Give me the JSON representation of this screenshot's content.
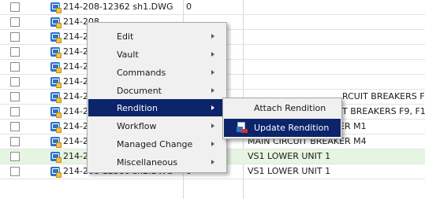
{
  "rows": [
    {
      "name": "214-208-12362 sh1.DWG",
      "version": "0",
      "description": "",
      "highlight": false
    },
    {
      "name": "214-208",
      "version": "",
      "description": "",
      "highlight": false
    },
    {
      "name": "214-208",
      "version": "",
      "description": "",
      "highlight": false
    },
    {
      "name": "214-208",
      "version": "",
      "description": "",
      "highlight": false
    },
    {
      "name": "214-208",
      "version": "",
      "description": "",
      "highlight": false
    },
    {
      "name": "214-208",
      "version": "",
      "description": "",
      "highlight": false
    },
    {
      "name": "214-208",
      "version": "",
      "description": "RCUIT BREAKERS F",
      "highlight": false
    },
    {
      "name": "214-208",
      "version": "",
      "description": "T BREAKERS F9, F1",
      "highlight": false
    },
    {
      "name": "214-208",
      "version": "",
      "description": "MAIN CIRCUIT BREAKER M1",
      "highlight": false
    },
    {
      "name": "214-208",
      "version": "",
      "description": "MAIN CIRCUIT BREAKER M4",
      "highlight": false
    },
    {
      "name": "214-208-12380 sh1.DWG",
      "version": "0",
      "description": "VS1 LOWER UNIT 1",
      "highlight": true
    },
    {
      "name": "214-208-12380 sh2.DWG",
      "version": "0",
      "description": "VS1 LOWER UNIT 1",
      "highlight": false
    }
  ],
  "context_menu": {
    "items": [
      {
        "label": "Edit",
        "has_submenu": true,
        "active": false
      },
      {
        "label": "Vault",
        "has_submenu": true,
        "active": false
      },
      {
        "label": "Commands",
        "has_submenu": true,
        "active": false
      },
      {
        "label": "Document",
        "has_submenu": true,
        "active": false
      },
      {
        "label": "Rendition",
        "has_submenu": true,
        "active": true
      },
      {
        "label": "Workflow",
        "has_submenu": true,
        "active": false
      },
      {
        "label": "Managed Change",
        "has_submenu": true,
        "active": false
      },
      {
        "label": "Miscellaneous",
        "has_submenu": true,
        "active": false
      }
    ],
    "highlight_color": "#0b246a"
  },
  "rendition_submenu": {
    "items": [
      {
        "label": "Attach Rendition",
        "icon": "",
        "active": false
      },
      {
        "label": "Update Rendition",
        "icon": "update-rendition-icon",
        "active": true
      }
    ]
  },
  "colors": {
    "row_highlight": "#e6f5e1",
    "file_icon": "#2e73c4"
  }
}
